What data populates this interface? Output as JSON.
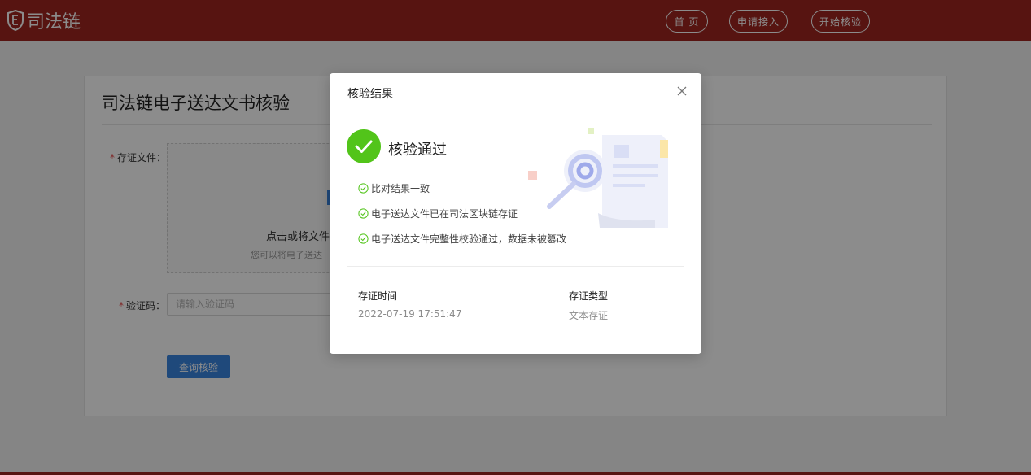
{
  "header": {
    "logo_text": "司法链",
    "nav": {
      "home": "首 页",
      "apply": "申请接入",
      "verify": "开始核验"
    }
  },
  "main": {
    "title": "司法链电子送达文书核验",
    "file_label": "存证文件：",
    "upload_text": "点击或将文件",
    "upload_hint": "您可以将电子送达",
    "code_label": "验证码：",
    "code_placeholder": "请输入验证码",
    "query_button": "查询核验"
  },
  "modal": {
    "title": "核验结果",
    "status": "核验通过",
    "checks": [
      "比对结果一致",
      "电子送达文件已在司法区块链存证",
      "电子送达文件完整性校验通过，数据未被篡改"
    ],
    "time_label": "存证时间",
    "time_value": "2022-07-19 17:51:47",
    "type_label": "存证类型",
    "type_value": "文本存证"
  },
  "colors": {
    "brand": "#9e2620",
    "primary": "#3a86e0",
    "success": "#52c41a"
  },
  "icons": {
    "logo": "shield-icon",
    "close": "close-icon",
    "status": "check-circle-icon",
    "check": "check-circle-outline-icon",
    "illustration": "document-magnifier-illustration"
  }
}
